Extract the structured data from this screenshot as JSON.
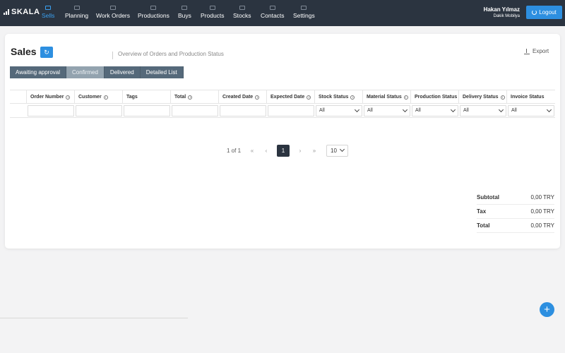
{
  "app": {
    "logo_text": "SKALA",
    "accent_color": "#2d8fe0",
    "nav_bg": "#2b3440"
  },
  "nav": [
    {
      "label": "Sells",
      "icon": "receipt-icon",
      "active": true
    },
    {
      "label": "Planning",
      "icon": "eye-icon"
    },
    {
      "label": "Work Orders",
      "icon": "envelope-icon"
    },
    {
      "label": "Productions",
      "icon": "gear-icon"
    },
    {
      "label": "Buys",
      "icon": "cart-icon"
    },
    {
      "label": "Products",
      "icon": "cube-icon"
    },
    {
      "label": "Stocks",
      "icon": "folder-icon"
    },
    {
      "label": "Contacts",
      "icon": "user-icon"
    },
    {
      "label": "Settings",
      "icon": "gear-icon"
    }
  ],
  "user": {
    "name": "Hakan Yılmaz",
    "company": "Dakik Mobilya"
  },
  "logout_label": "Logout",
  "page": {
    "title": "Sales",
    "subtitle": "Overview of Orders and Production Status",
    "export_label": "Export"
  },
  "tabs": [
    {
      "label": "Awaiting approval"
    },
    {
      "label": "Confirmed",
      "active": true
    },
    {
      "label": "Delivered"
    },
    {
      "label": "Detailed List"
    }
  ],
  "table": {
    "columns": [
      {
        "label": "Order Number",
        "info": true
      },
      {
        "label": "Customer",
        "info": true
      },
      {
        "label": "Tags",
        "info": false
      },
      {
        "label": "Total",
        "info": true
      },
      {
        "label": "Created Date",
        "info": true
      },
      {
        "label": "Expected Date",
        "info": true
      },
      {
        "label": "Stock Status",
        "info": true
      },
      {
        "label": "Material Status",
        "info": true
      },
      {
        "label": "Production Status",
        "info": true
      },
      {
        "label": "Delivery Status",
        "info": true
      },
      {
        "label": "Invoice Status",
        "info": false
      }
    ],
    "filter_select_value": "All"
  },
  "pagination": {
    "info": "1 of 1",
    "first": "«",
    "prev": "‹",
    "current": "1",
    "next": "›",
    "last": "»",
    "page_size": "10"
  },
  "totals": [
    {
      "label": "Subtotal",
      "value": "0,00 TRY"
    },
    {
      "label": "Tax",
      "value": "0,00 TRY"
    },
    {
      "label": "Total",
      "value": "0,00 TRY"
    }
  ],
  "fab_label": "+"
}
